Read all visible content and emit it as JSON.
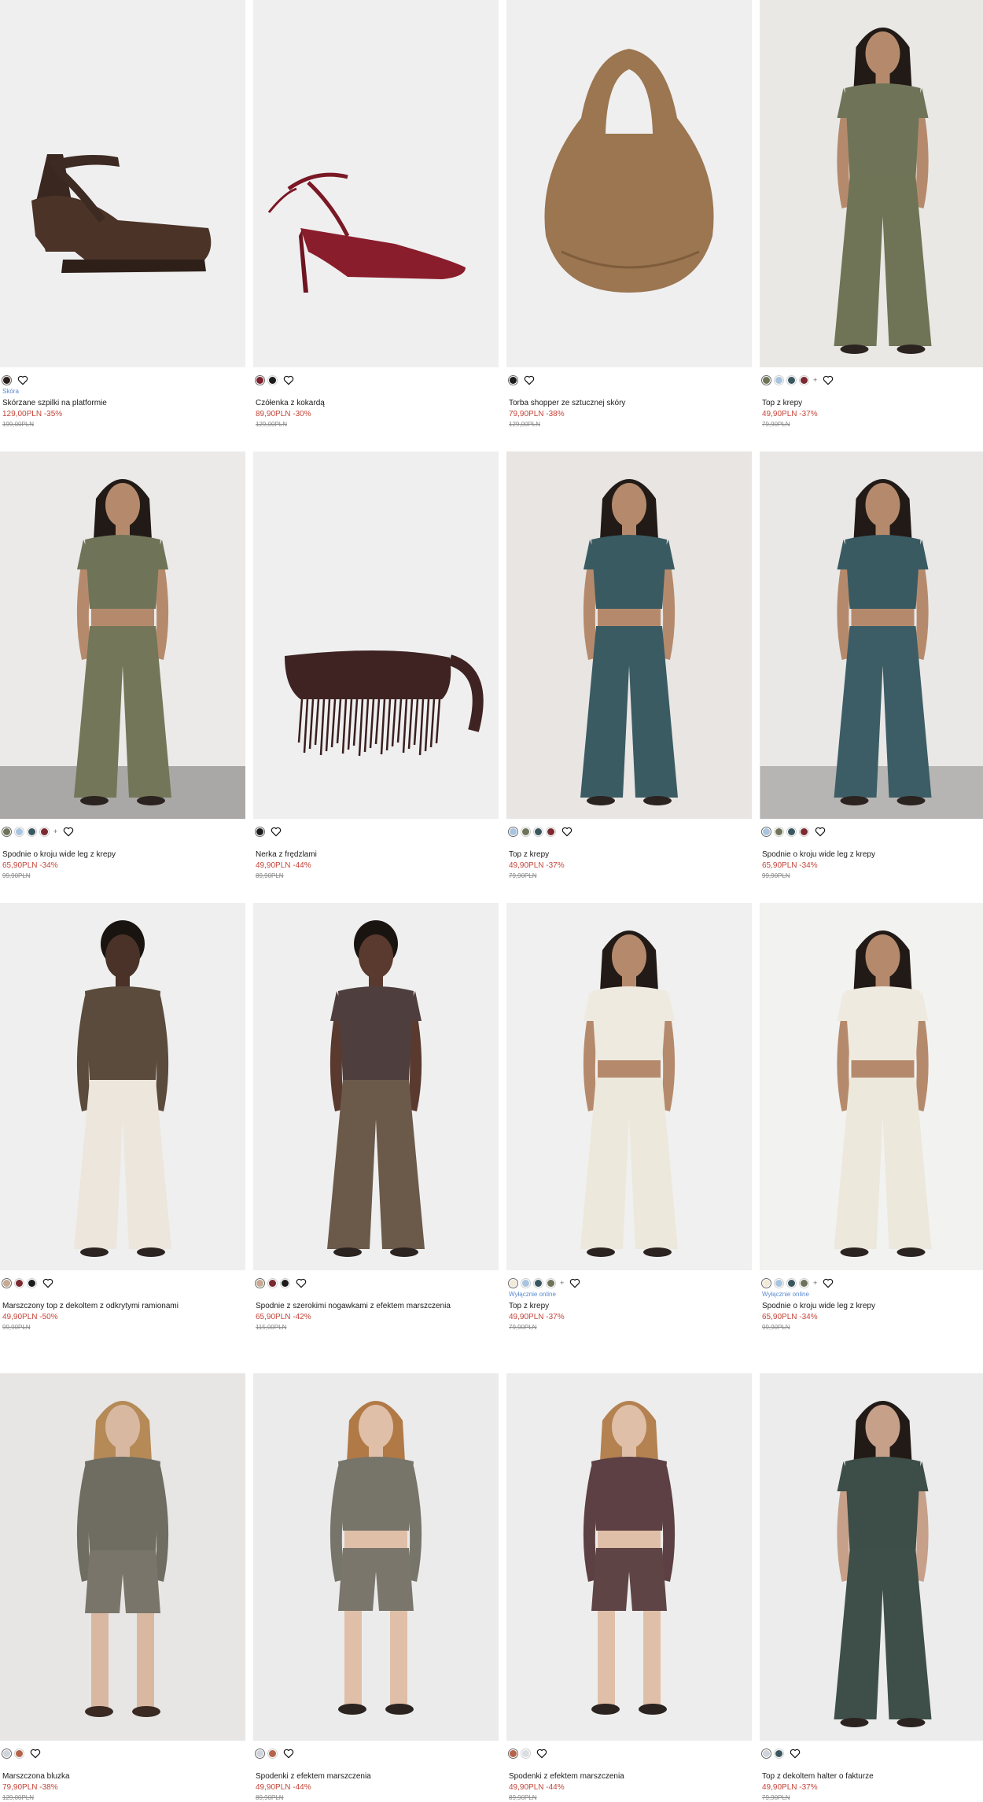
{
  "colors": {
    "sale": "#c4453a",
    "badge": "#5b8bd0",
    "image_bg": "#efeff0"
  },
  "products": [
    {
      "name": "Skórzane szpilki na platformie",
      "badge": "Skóra",
      "price": "129,00PLN",
      "discount": "-35%",
      "old_price": "199,00PLN",
      "swatches": [
        "#2a1f1a"
      ],
      "more_colors": "",
      "image": "platform-heel"
    },
    {
      "name": "Czółenka z kokardą",
      "badge": "",
      "price": "89,90PLN",
      "discount": "-30%",
      "old_price": "129,00PLN",
      "swatches": [
        "#7e1f2c",
        "#1c1c1c"
      ],
      "more_colors": "",
      "image": "red-pump"
    },
    {
      "name": "Torba shopper ze sztucznej skóry",
      "badge": "",
      "price": "79,90PLN",
      "discount": "-38%",
      "old_price": "129,00PLN",
      "swatches": [
        "#1c1c1c"
      ],
      "more_colors": "",
      "image": "suede-bag"
    },
    {
      "name": "Top z krepy",
      "badge": "",
      "price": "49,90PLN",
      "discount": "-37%",
      "old_price": "79,90PLN",
      "swatches": [
        "#6f7458",
        "#a8c4df",
        "#3a5760",
        "#7a2a30"
      ],
      "more_colors": "+",
      "image": "model-olive-top"
    },
    {
      "name": "Spodnie o kroju wide leg z krepy",
      "badge": "",
      "price": "65,90PLN",
      "discount": "-34%",
      "old_price": "99,90PLN",
      "swatches": [
        "#6f7458",
        "#a8c4df",
        "#3a5760",
        "#7a2a30"
      ],
      "more_colors": "+",
      "image": "model-olive-set"
    },
    {
      "name": "Nerka z frędzlami",
      "badge": "",
      "price": "49,90PLN",
      "discount": "-44%",
      "old_price": "89,90PLN",
      "swatches": [
        "#1c1c1c"
      ],
      "more_colors": "",
      "image": "fringe-bag"
    },
    {
      "name": "Top z krepy",
      "badge": "",
      "price": "49,90PLN",
      "discount": "-37%",
      "old_price": "79,90PLN",
      "swatches": [
        "#a8c4df",
        "#6f7458",
        "#3a5760",
        "#7a2a30"
      ],
      "more_colors": "",
      "image": "model-teal-top"
    },
    {
      "name": "Spodnie o kroju wide leg z krepy",
      "badge": "",
      "price": "65,90PLN",
      "discount": "-34%",
      "old_price": "99,90PLN",
      "swatches": [
        "#a8c4df",
        "#6f7458",
        "#3a5760",
        "#7a2a30"
      ],
      "more_colors": "",
      "image": "model-teal-set"
    },
    {
      "name": "Marszczony top z dekoltem z odkrytymi ramionami",
      "badge": "",
      "price": "49,90PLN",
      "discount": "-50%",
      "old_price": "99,90PLN",
      "swatches": [
        "#c7a992",
        "#7a2a30",
        "#1c1c1c"
      ],
      "more_colors": "",
      "image": "model-brown-offshoulder"
    },
    {
      "name": "Spodnie z szerokimi nogawkami z efektem marszczenia",
      "badge": "",
      "price": "65,90PLN",
      "discount": "-42%",
      "old_price": "115,00PLN",
      "swatches": [
        "#c7a992",
        "#7a2a30",
        "#1c1c1c"
      ],
      "more_colors": "",
      "image": "model-brown-pants"
    },
    {
      "name": "Top z krepy",
      "badge": "Wyłącznie online",
      "price": "49,90PLN",
      "discount": "-37%",
      "old_price": "79,90PLN",
      "swatches": [
        "#f1ead8",
        "#a8c4df",
        "#3a5760",
        "#6f7458"
      ],
      "more_colors": "+",
      "image": "model-cream-top"
    },
    {
      "name": "Spodnie o kroju wide leg z krepy",
      "badge": "Wyłącznie online",
      "price": "65,90PLN",
      "discount": "-34%",
      "old_price": "99,90PLN",
      "swatches": [
        "#f1ead8",
        "#a8c4df",
        "#3a5760",
        "#6f7458"
      ],
      "more_colors": "+",
      "image": "model-cream-set"
    },
    {
      "name": "Marszczona bluzka",
      "badge": "",
      "price": "79,90PLN",
      "discount": "-38%",
      "old_price": "129,00PLN",
      "swatches": [
        "#cfd4dc",
        "#b4644a"
      ],
      "more_colors": "",
      "image": "model-grey-cardigan"
    },
    {
      "name": "Spodenki z efektem marszczenia",
      "badge": "",
      "price": "49,90PLN",
      "discount": "-44%",
      "old_price": "89,90PLN",
      "swatches": [
        "#cfd4dc",
        "#b4644a"
      ],
      "more_colors": "",
      "image": "model-grey-shorts"
    },
    {
      "name": "Spodenki z efektem marszczenia",
      "badge": "",
      "price": "49,90PLN",
      "discount": "-44%",
      "old_price": "89,90PLN",
      "swatches": [
        "#b4644a",
        "#dadde2"
      ],
      "more_colors": "",
      "image": "model-plum-shorts"
    },
    {
      "name": "Top z dekoltem halter o fakturze",
      "badge": "",
      "price": "49,90PLN",
      "discount": "-37%",
      "old_price": "79,90PLN",
      "swatches": [
        "#cfd4dc",
        "#3a5760"
      ],
      "more_colors": "",
      "image": "model-green-halter"
    }
  ]
}
